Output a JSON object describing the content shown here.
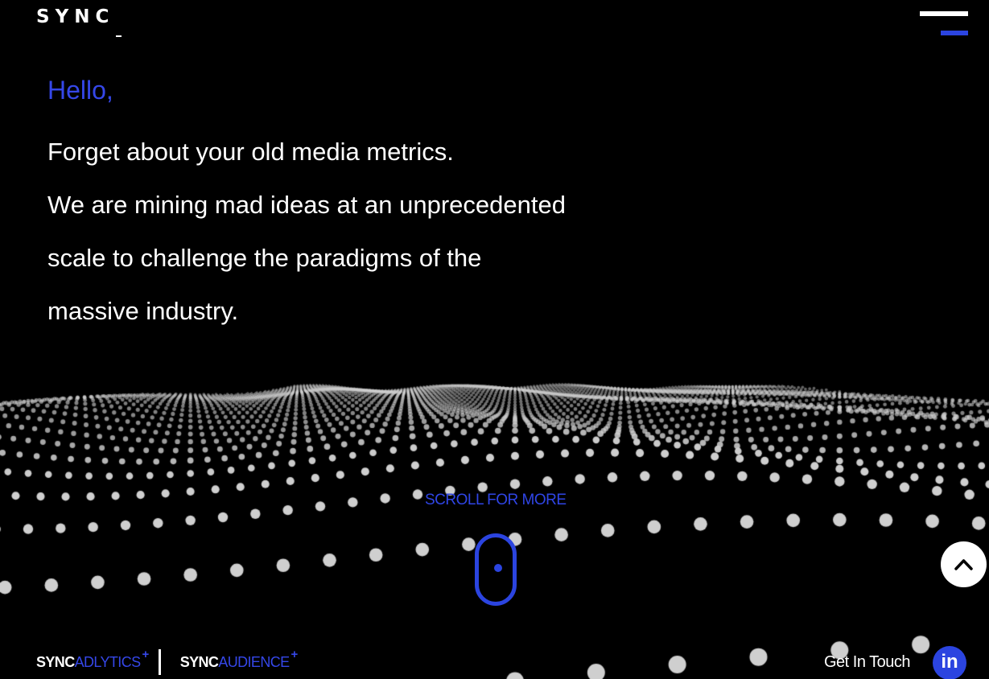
{
  "header": {
    "logo_text": "SYNC",
    "menu_icon": "hamburger-menu-icon"
  },
  "hero": {
    "greeting": "Hello,",
    "lines": [
      "Forget about your old media metrics.",
      "We are mining mad ideas at an unprecedented",
      "scale to challenge the paradigms of the",
      "massive industry."
    ]
  },
  "scroll": {
    "label": "SCROLL FOR MORE",
    "icon": "mouse-scroll-icon"
  },
  "back_to_top": {
    "icon": "chevron-up-icon"
  },
  "footer": {
    "brands": [
      {
        "prefix": "SYNC",
        "name": "ADLYTICS",
        "suffix": "+"
      },
      {
        "prefix": "SYNC",
        "name": "AUDIENCE",
        "suffix": "+"
      }
    ],
    "contact_label": "Get In Touch",
    "linkedin_label": "in"
  },
  "colors": {
    "background": "#000000",
    "accent": "#2b44e0",
    "text": "#ffffff",
    "dots": "#cfcfcf"
  }
}
